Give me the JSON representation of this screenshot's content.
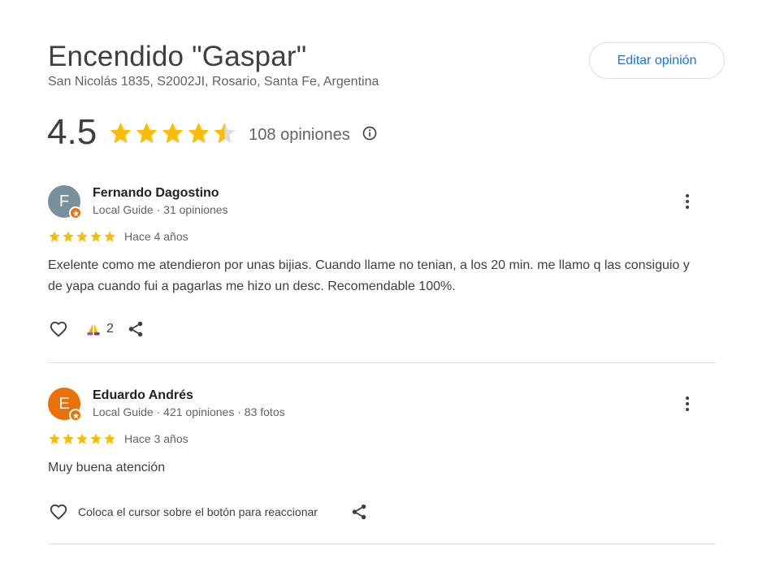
{
  "place": {
    "name": "Encendido \"Gaspar\"",
    "address": "San Nicolás 1835, S2002JI, Rosario, Santa Fe, Argentina"
  },
  "edit_button": {
    "label": "Editar opinión"
  },
  "rating": {
    "value": "4.5",
    "stars": 4.5,
    "count_label": "108 opiniones"
  },
  "reviews": [
    {
      "avatar_letter": "F",
      "avatar_color": "#78909c",
      "name": "Fernando Dagostino",
      "meta": "Local Guide · 31 opiniones",
      "stars": 5,
      "date": "Hace 4 años",
      "text": "Exelente como me atendieron por unas bijias. Cuando llame no tenian, a los 20 min. me llamo q las consiguio y de yapa cuando fui a pagarlas me hizo un desc. Recomendable 100%.",
      "reaction_count": "2"
    },
    {
      "avatar_letter": "E",
      "avatar_color": "#e8710a",
      "name": "Eduardo Andrés",
      "meta": "Local Guide · 421 opiniones · 83 fotos",
      "stars": 5,
      "date": "Hace 3 años",
      "text": "Muy buena atención",
      "hover_hint": "Coloca el cursor sobre el botón para reaccionar"
    }
  ],
  "colors": {
    "star": "#fbbc04",
    "star_empty": "#dadce0",
    "accent": "#1a73e8",
    "badge": "#e8710a"
  },
  "icons": [
    "star-icon",
    "info-icon",
    "more-vert-icon",
    "heart-icon",
    "praying-hands-icon",
    "share-icon",
    "local-guide-badge-icon"
  ]
}
